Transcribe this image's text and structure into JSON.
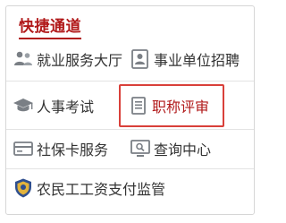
{
  "panel": {
    "title": "快捷通道"
  },
  "items": [
    {
      "label": "就业服务大厅",
      "icon": "people-group-icon"
    },
    {
      "label": "事业单位招聘",
      "icon": "id-card-icon"
    },
    {
      "label": "人事考试",
      "icon": "graduation-cap-icon"
    },
    {
      "label": "职称评审",
      "icon": "document-icon",
      "highlighted": true
    },
    {
      "label": "社保卡服务",
      "icon": "card-icon"
    },
    {
      "label": "查询中心",
      "icon": "monitor-search-icon"
    },
    {
      "label": "农民工工资支付监管",
      "icon": "shield-badge-icon"
    }
  ],
  "colors": {
    "accent": "#b1191a",
    "highlight_border": "#d9403a",
    "icon_gray": "#7a7f85"
  }
}
